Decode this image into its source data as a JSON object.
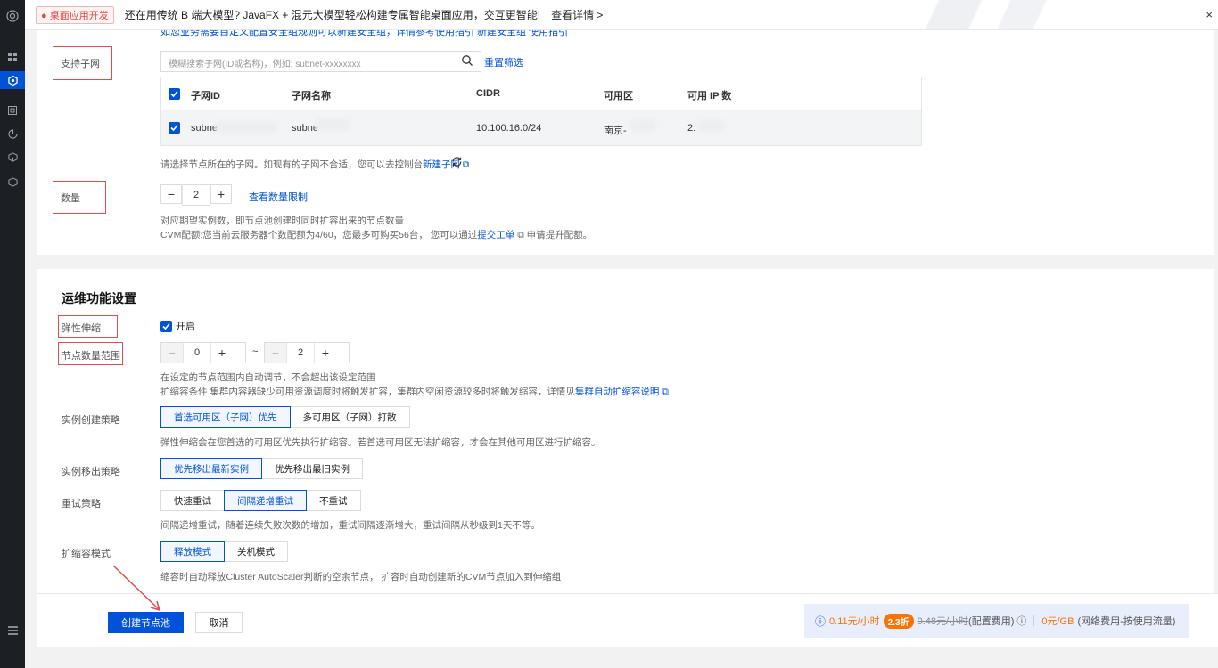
{
  "banner": {
    "tag": "● 桌面应用开发",
    "text": "还在用传统 B 端大模型? JavaFX + 混元大模型轻松构建专属智能桌面应用，交互更智能!",
    "link": "查看详情 >",
    "close": "×"
  },
  "sidebar": {
    "icons": [
      "logo-icon",
      "grid-icon",
      "cluster-icon",
      "monitor-icon",
      "pie-icon",
      "package-icon",
      "shield-icon"
    ],
    "bottom_icon": "menu-icon"
  },
  "subnet": {
    "top_cut_text": "如您业务需要自定义配置安全组规则可以新建安全组，详情参考使用指引  新建安全组  使用指引",
    "label": "支持子网",
    "search_placeholder": "模糊搜索子网(ID或名称)，例如: subnet-xxxxxxxx",
    "reset": "重置筛选",
    "columns": [
      "子网ID",
      "子网名称",
      "CIDR",
      "可用区",
      "可用 IP 数"
    ],
    "row": {
      "id": "subne",
      "name": "subne",
      "cidr": "10.100.16.0/24",
      "zone": "南京-",
      "ips": "2:"
    },
    "hint_prefix": "请选择节点所在的子网。如现有的子网不合适，您可以去控制台",
    "hint_link": "新建子网",
    "hint_ext": "⧉"
  },
  "count": {
    "label": "数量",
    "value": "2",
    "minus": "−",
    "plus": "+",
    "limit_link": "查看数量限制",
    "hint1": "对应期望实例数，即节点池创建时同时扩容出来的节点数量",
    "hint2_prefix": "CVM配额:您当前云服务器个数配额为4/60，您最多可购买56台，  您可以通过",
    "hint2_link": "提交工单",
    "hint2_suffix": "⧉ 申请提升配额。"
  },
  "ops": {
    "title": "运维功能设置",
    "autoscale_label": "弹性伸缩",
    "autoscale_text": "开启",
    "range_label": "节点数量范围",
    "range_min": "0",
    "range_max": "2",
    "range_sep": "~",
    "range_hint": "在设定的节点范围内自动调节，不会超出该设定范围",
    "range_hint2_prefix": "扩缩容条件 集群内容器缺少可用资源调度时将触发扩容，集群内空闲资源较多时将触发缩容，详情见",
    "range_hint2_link": "集群自动扩缩容说明",
    "create_label": "实例创建策略",
    "create_options": [
      "首选可用区（子网）优先",
      "多可用区（子网）打散"
    ],
    "create_hint": "弹性伸缩会在您首选的可用区优先执行扩缩容。若首选可用区无法扩缩容，才会在其他可用区进行扩缩容。",
    "remove_label": "实例移出策略",
    "remove_options": [
      "优先移出最新实例",
      "优先移出最旧实例"
    ],
    "retry_label": "重试策略",
    "retry_options": [
      "快速重试",
      "间隔递增重试",
      "不重试"
    ],
    "retry_hint": "间隔递增重试，随着连续失败次数的增加，重试间隔逐渐增大，重试间隔从秒级到1天不等。",
    "scale_label": "扩缩容模式",
    "scale_options": [
      "释放模式",
      "关机模式"
    ],
    "scale_hint": "缩容时自动释放Cluster AutoScaler判断的空余节点， 扩容时自动创建新的CVM节点加入到伸缩组"
  },
  "footer": {
    "create": "创建节点池",
    "cancel": "取消",
    "price_icon": "ⓘ",
    "price": "0.11元/小时",
    "discount": "2.3折",
    "orig": "0.48元/小时",
    "orig_note": "(配置费用)",
    "net_price": "0元/GB",
    "net_note": "(网络费用-按使用流量)"
  },
  "colors": {
    "primary": "#0052d9",
    "annotation": "#e34d4d",
    "price": "#ff7200"
  }
}
